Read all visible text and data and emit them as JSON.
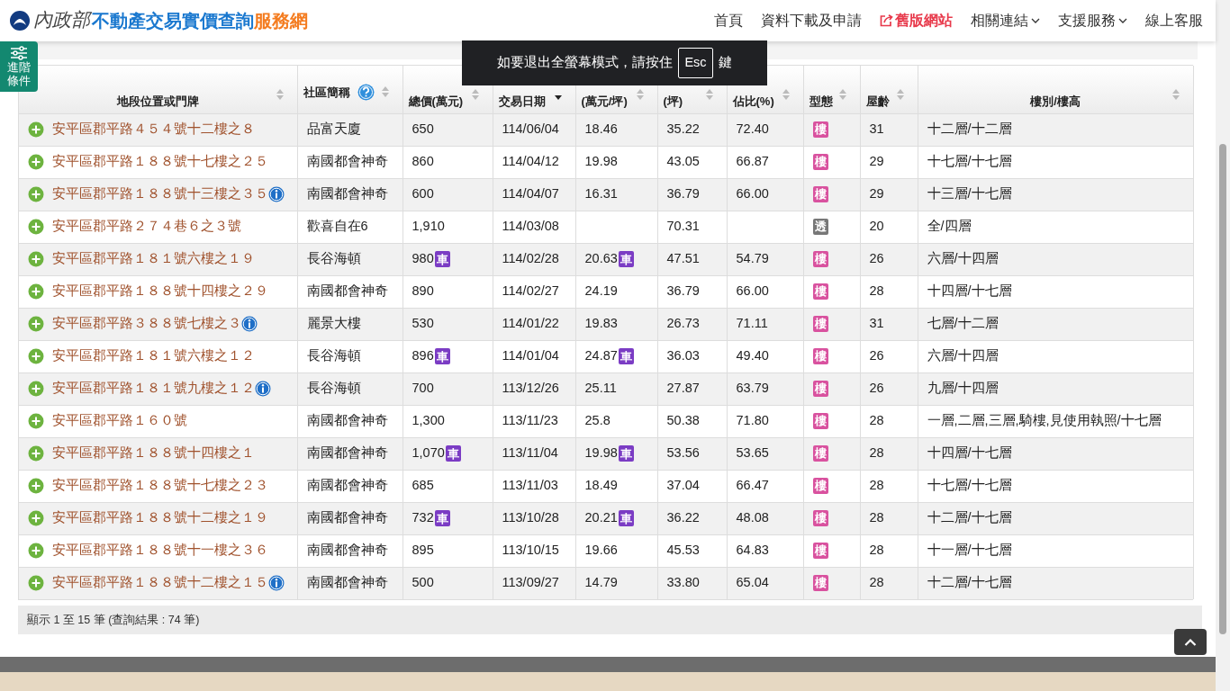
{
  "header": {
    "logo_ministry": "內政部",
    "logo_title": "不動產交易實價查詢",
    "logo_suffix": "服務網",
    "nav": [
      {
        "label": "首頁",
        "kind": "link"
      },
      {
        "label": "資料下載及申請",
        "kind": "link"
      },
      {
        "label": "舊版網站",
        "kind": "external"
      },
      {
        "label": "相關連結",
        "kind": "dropdown"
      },
      {
        "label": "支援服務",
        "kind": "dropdown"
      },
      {
        "label": "線上客服",
        "kind": "link"
      }
    ]
  },
  "side_tab": "進階條件",
  "toast": {
    "before": "如要退出全螢幕模式，請按住",
    "key": "Esc",
    "after": "鍵"
  },
  "table": {
    "columns": [
      {
        "label": "地段位置或門牌",
        "sorted": false,
        "help": false
      },
      {
        "label": "社區簡稱",
        "sorted": false,
        "help": true
      },
      {
        "label": "總價(萬元)",
        "sorted": false,
        "help": false
      },
      {
        "label": "交易日期",
        "sorted": true,
        "help": false
      },
      {
        "label": "(萬元/坪)",
        "sorted": false,
        "help": false
      },
      {
        "label": "(坪)",
        "sorted": false,
        "help": false
      },
      {
        "label": "佔比(%)",
        "sorted": false,
        "help": false
      },
      {
        "label": "型態",
        "sorted": false,
        "help": false
      },
      {
        "label": "屋齡",
        "sorted": false,
        "help": false
      },
      {
        "label": "樓別/樓高",
        "sorted": false,
        "help": false
      }
    ],
    "rows": [
      {
        "address": "安平區郡平路４５４號十二樓之８",
        "info": false,
        "community": "品富天廈",
        "price": "650",
        "date": "114/06/04",
        "unit": "18.46",
        "area": "35.22",
        "ratio": "72.40",
        "type": "樓",
        "color": "#d9529f",
        "age": "31",
        "floors": "十二層/十二層"
      },
      {
        "address": "安平區郡平路１８８號十七樓之２５",
        "info": false,
        "community": "南國都會神奇",
        "price": "860",
        "date": "114/04/12",
        "unit": "19.98",
        "area": "43.05",
        "ratio": "66.87",
        "type": "樓",
        "color": "#d9529f",
        "age": "29",
        "floors": "十七層/十七層"
      },
      {
        "address": "安平區郡平路１８８號十三樓之３５",
        "info": true,
        "community": "南國都會神奇",
        "price": "600",
        "date": "114/04/07",
        "unit": "16.31",
        "area": "36.79",
        "ratio": "66.00",
        "type": "樓",
        "color": "#d9529f",
        "age": "29",
        "floors": "十三層/十七層"
      },
      {
        "address": "安平區郡平路２７４巷６之３號",
        "info": false,
        "community": "歡喜自在6",
        "price": "1,910",
        "date": "114/03/08",
        "area": "70.31",
        "type": "透",
        "color": "#777777",
        "age": "20",
        "floors": "全/四層"
      },
      {
        "address": "安平區郡平路１８１號六樓之１９",
        "info": false,
        "community": "長谷海頓",
        "price": "980",
        "price_badge": "車",
        "date": "114/02/28",
        "unit": "20.63",
        "unit_badge": "車",
        "area": "47.51",
        "ratio": "54.79",
        "type": "樓",
        "color": "#d9529f",
        "age": "26",
        "floors": "六層/十四層"
      },
      {
        "address": "安平區郡平路１８８號十四樓之２９",
        "info": false,
        "community": "南國都會神奇",
        "price": "890",
        "date": "114/02/27",
        "unit": "24.19",
        "area": "36.79",
        "ratio": "66.00",
        "type": "樓",
        "color": "#d9529f",
        "age": "28",
        "floors": "十四層/十七層"
      },
      {
        "address": "安平區郡平路３８８號七樓之３",
        "info": true,
        "community": "麗景大樓",
        "price": "530",
        "date": "114/01/22",
        "unit": "19.83",
        "area": "26.73",
        "ratio": "71.11",
        "type": "樓",
        "color": "#d9529f",
        "age": "31",
        "floors": "七層/十二層"
      },
      {
        "address": "安平區郡平路１８１號六樓之１２",
        "info": false,
        "community": "長谷海頓",
        "price": "896",
        "price_badge": "車",
        "date": "114/01/04",
        "unit": "24.87",
        "unit_badge": "車",
        "area": "36.03",
        "ratio": "49.40",
        "type": "樓",
        "color": "#d9529f",
        "age": "26",
        "floors": "六層/十四層"
      },
      {
        "address": "安平區郡平路１８１號九樓之１２",
        "info": true,
        "community": "長谷海頓",
        "price": "700",
        "date": "113/12/26",
        "unit": "25.11",
        "area": "27.87",
        "ratio": "63.79",
        "type": "樓",
        "color": "#d9529f",
        "age": "26",
        "floors": "九層/十四層"
      },
      {
        "address": "安平區郡平路１６０號",
        "info": false,
        "community": "南國都會神奇",
        "price": "1,300",
        "date": "113/11/23",
        "unit": "25.8",
        "area": "50.38",
        "ratio": "71.80",
        "type": "樓",
        "color": "#d9529f",
        "age": "28",
        "floors": "一層,二層,三層,騎樓,見使用執照/十七層"
      },
      {
        "address": "安平區郡平路１８８號十四樓之１",
        "info": false,
        "community": "南國都會神奇",
        "price": "1,070",
        "price_badge": "車",
        "date": "113/11/04",
        "unit": "19.98",
        "unit_badge": "車",
        "area": "53.56",
        "ratio": "53.65",
        "type": "樓",
        "color": "#d9529f",
        "age": "28",
        "floors": "十四層/十七層"
      },
      {
        "address": "安平區郡平路１８８號十七樓之２３",
        "info": false,
        "community": "南國都會神奇",
        "price": "685",
        "date": "113/11/03",
        "unit": "18.49",
        "area": "37.04",
        "ratio": "66.47",
        "type": "樓",
        "color": "#d9529f",
        "age": "28",
        "floors": "十七層/十七層"
      },
      {
        "address": "安平區郡平路１８８號十二樓之１９",
        "info": false,
        "community": "南國都會神奇",
        "price": "732",
        "price_badge": "車",
        "date": "113/10/28",
        "unit": "20.21",
        "unit_badge": "車",
        "area": "36.22",
        "ratio": "48.08",
        "type": "樓",
        "color": "#d9529f",
        "age": "28",
        "floors": "十二層/十七層"
      },
      {
        "address": "安平區郡平路１８８號十一樓之３６",
        "info": false,
        "community": "南國都會神奇",
        "price": "895",
        "date": "113/10/15",
        "unit": "19.66",
        "area": "45.53",
        "ratio": "64.83",
        "type": "樓",
        "color": "#d9529f",
        "age": "28",
        "floors": "十一層/十七層"
      },
      {
        "address": "安平區郡平路１８８號十二樓之１５",
        "info": true,
        "community": "南國都會神奇",
        "price": "500",
        "date": "113/09/27",
        "unit": "14.79",
        "area": "33.80",
        "ratio": "65.04",
        "type": "樓",
        "color": "#d9529f",
        "age": "28",
        "floors": "十二層/十七層"
      }
    ]
  },
  "summary": "顯示 1 至 15 筆 (查詢結果 : 74 筆)"
}
